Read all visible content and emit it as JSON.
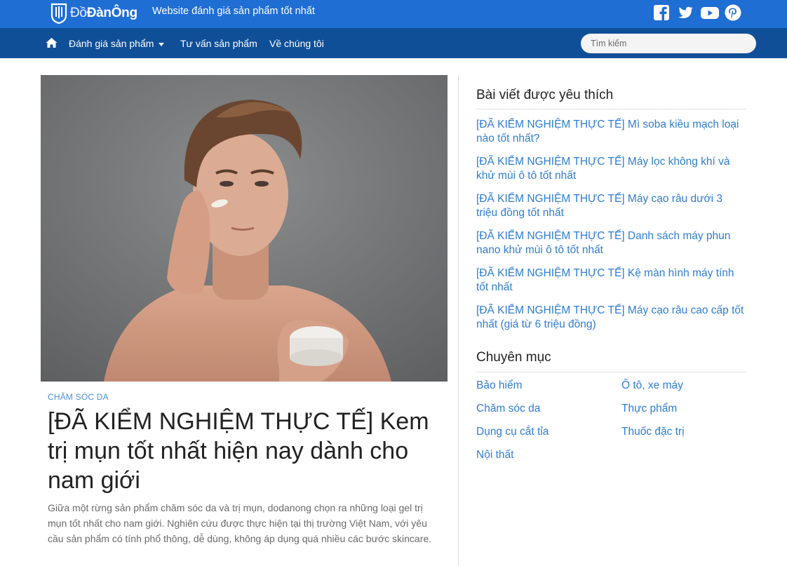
{
  "header": {
    "logo_text_light": "Đồ",
    "logo_text_bold": "ĐànÔng",
    "tagline": "Website đánh giá sản phẩm tốt nhất",
    "social_icons": [
      "facebook-icon",
      "twitter-icon",
      "youtube-icon",
      "pinterest-icon"
    ],
    "colors": {
      "topbar": "#1f6ed4",
      "navbar": "#0f4f97",
      "link": "#2f7dd1"
    }
  },
  "nav": {
    "items": [
      {
        "label": "Đánh giá sản phẩm",
        "has_dropdown": true
      },
      {
        "label": "Tư vấn sản phẩm",
        "has_dropdown": false
      },
      {
        "label": "Về chúng tôi",
        "has_dropdown": false
      }
    ],
    "search_placeholder": "Tìm kiếm"
  },
  "article": {
    "category": "CHĂM SÓC DA",
    "title": "[ĐÃ KIỂM NGHIỆM THỰC TẾ] Kem trị mụn tốt nhất hiện nay dành cho nam giới",
    "excerpt": "Giữa một rừng sản phẩm chăm sóc da và trị mụn, dodanong chọn ra những loại gel trị mụn tốt nhất cho nam giới. Nghiên cứu được thực hiện tại thị trường Việt Nam, với yêu cầu sản phẩm có tính phổ thông, dễ dùng, không áp dụng quá nhiều các bước skincare."
  },
  "sidebar": {
    "popular_heading": "Bài viết được yêu thích",
    "popular": [
      "[ĐÃ KIỂM NGHIỆM THỰC TẾ] Mì soba kiều mạch loại nào tốt nhất?",
      "[ĐÃ KIỂM NGHIỆM THỰC TẾ] Máy lọc không khí và khử mùi ô tô tốt nhất",
      "[ĐÃ KIỂM NGHIỆM THỰC TẾ] Máy cạo râu dưới 3 triệu đồng tốt nhất",
      "[ĐÃ KIỂM NGHIỆM THỰC TẾ] Danh sách máy phun nano khử mùi ô tô tốt nhất",
      "[ĐÃ KIỂM NGHIỆM THỰC TẾ] Kệ màn hình máy tính tốt nhất",
      "[ĐÃ KIỂM NGHIỆM THỰC TẾ] Máy cạo râu cao cấp tốt nhất (giá từ 6 triệu đồng)"
    ],
    "categories_heading": "Chuyên mục",
    "categories": [
      "Bảo hiểm",
      "Ô tô, xe máy",
      "Chăm sóc da",
      "Thực phẩm",
      "Dụng cụ cắt tỉa",
      "Thuốc đặc trị",
      "Nội thất"
    ]
  }
}
